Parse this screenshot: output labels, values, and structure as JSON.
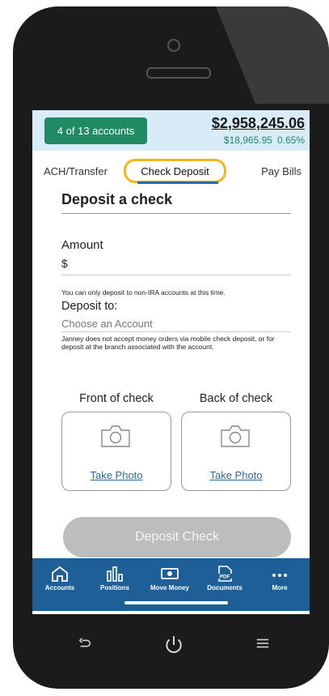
{
  "header": {
    "accounts_button": "4 of 13 accounts",
    "total_value": "$2,958,245.06",
    "change_amount": "$18,965.95",
    "change_percent": "0.65%"
  },
  "tabs": [
    {
      "label": "ACH/Transfer"
    },
    {
      "label": "Check Deposit"
    },
    {
      "label": "Pay Bills"
    }
  ],
  "form": {
    "title": "Deposit a check",
    "amount_label": "Amount",
    "amount_value": "$",
    "non_ira_note": "You can only deposit to non-IRA accounts at this time.",
    "deposit_to_label": "Deposit to:",
    "deposit_to_placeholder": "Choose an Account",
    "money_order_notice": "Janney does not accept money orders via mobile check deposit, or for deposit at the branch associated with the account.",
    "front_label": "Front of check",
    "back_label": "Back of check",
    "take_photo_front": "Take Photo",
    "take_photo_back": "Take Photo",
    "submit_label": "Deposit Check"
  },
  "bottom_nav": [
    {
      "label": "Accounts",
      "icon": "home-icon"
    },
    {
      "label": "Positions",
      "icon": "bar-chart-icon"
    },
    {
      "label": "Move Money",
      "icon": "money-icon"
    },
    {
      "label": "Documents",
      "icon": "pdf-icon"
    },
    {
      "label": "More",
      "icon": "more-icon"
    }
  ],
  "colors": {
    "accent": "#1f8a63",
    "nav_bg": "#1e5f98",
    "highlight": "#f2b61d",
    "header_bg": "#d8ecf8"
  }
}
